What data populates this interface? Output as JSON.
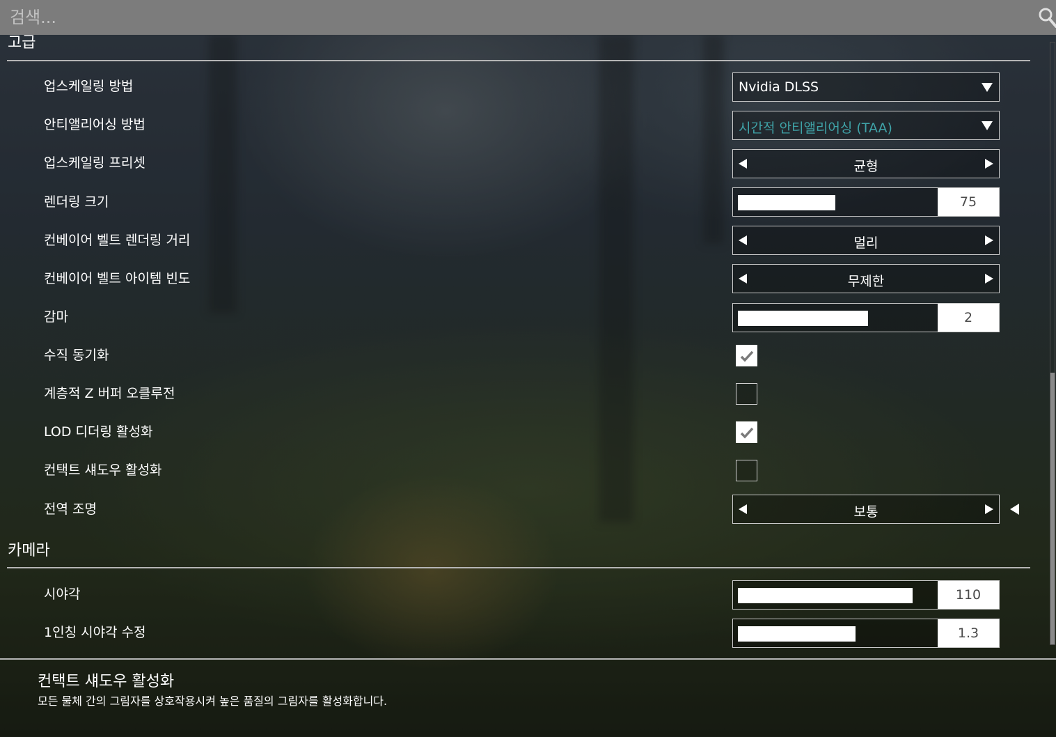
{
  "search": {
    "placeholder": "검색..."
  },
  "sections": {
    "advanced": {
      "title": "고급"
    },
    "camera": {
      "title": "카메라"
    }
  },
  "settings": {
    "upscaling_method": {
      "label": "업스케일링 방법",
      "value": "Nvidia DLSS"
    },
    "antialiasing_method": {
      "label": "안티앨리어싱 방법",
      "value": "시간적 안티앨리어싱 (TAA)"
    },
    "upscaling_preset": {
      "label": "업스케일링 프리셋",
      "value": "균형"
    },
    "render_scale": {
      "label": "렌더링 크기",
      "value": "75",
      "fill_fraction": 0.48
    },
    "conveyor_render_distance": {
      "label": "컨베이어 벨트 렌더링 거리",
      "value": "멀리"
    },
    "conveyor_item_frequency": {
      "label": "컨베이어 벨트 아이템 빈도",
      "value": "무제한"
    },
    "gamma": {
      "label": "감마",
      "value": "2",
      "fill_fraction": 0.64
    },
    "vsync": {
      "label": "수직 동기화",
      "checked": true
    },
    "hzb_occlusion": {
      "label": "계층적 Z 버퍼 오클루전",
      "checked": false
    },
    "lod_dithering": {
      "label": "LOD 디더링 활성화",
      "checked": true
    },
    "contact_shadows": {
      "label": "컨택트 섀도우 활성화",
      "checked": false
    },
    "global_illumination": {
      "label": "전역 조명",
      "value": "보통"
    },
    "fov": {
      "label": "시야각",
      "value": "110",
      "fill_fraction": 0.86
    },
    "first_person_fov": {
      "label": "1인칭 시야각 수정",
      "value": "1.3",
      "fill_fraction": 0.58
    }
  },
  "description": {
    "title": "컨택트 섀도우 활성화",
    "text": "모든 물체 간의 그림자를 상호작용시켜 높은 품질의 그림자를 활성화합니다."
  },
  "colors": {
    "accent_teal": "#3fa3a8",
    "search_bar": "#7c7c7c"
  }
}
